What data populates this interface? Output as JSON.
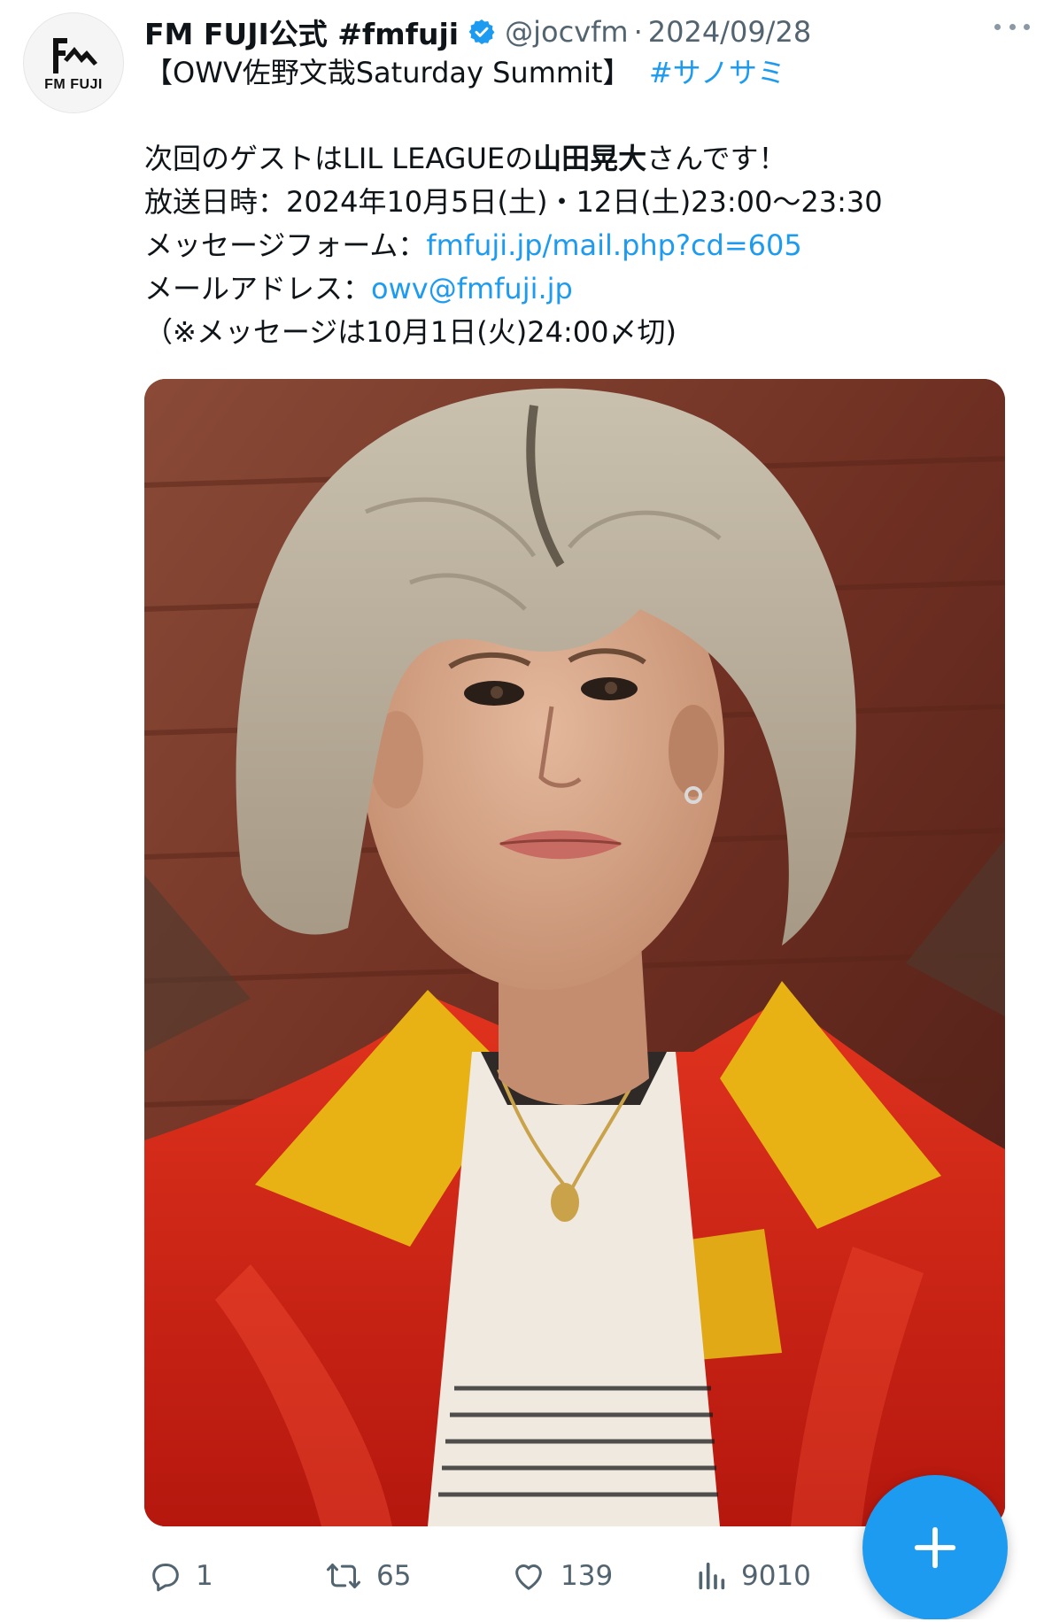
{
  "account": {
    "display_name": "FM FUJI公式 #fmfuji",
    "handle": "@jocvfm",
    "separator": "·",
    "date": "2024/09/28",
    "avatar_text": "FM FUJI",
    "verified_color": "#1d9bf0"
  },
  "tweet": {
    "line1": "【OWV佐野文哉Saturday Summit】",
    "hashtag": "#サノサミ",
    "guest_prefix": "次回のゲストはLIL LEAGUEの",
    "guest_name": "山田晃大",
    "guest_suffix": "さんです！",
    "broadcast": "放送日時：2024年10月5日(土)・12日(土)23:00〜23:30",
    "form_label": "メッセージフォーム：",
    "form_link": "fmfuji.jp/mail.php?cd=605",
    "mail_label": "メールアドレス：",
    "mail_link": "owv@fmfuji.jp",
    "deadline": "（※メッセージは10月1日(火)24:00〆切)"
  },
  "actions": {
    "replies": "1",
    "retweets": "65",
    "likes": "139",
    "views": "9010"
  },
  "colors": {
    "link": "#1d9bf0",
    "secondary_text": "#536471",
    "fab": "#1d9bf0"
  }
}
